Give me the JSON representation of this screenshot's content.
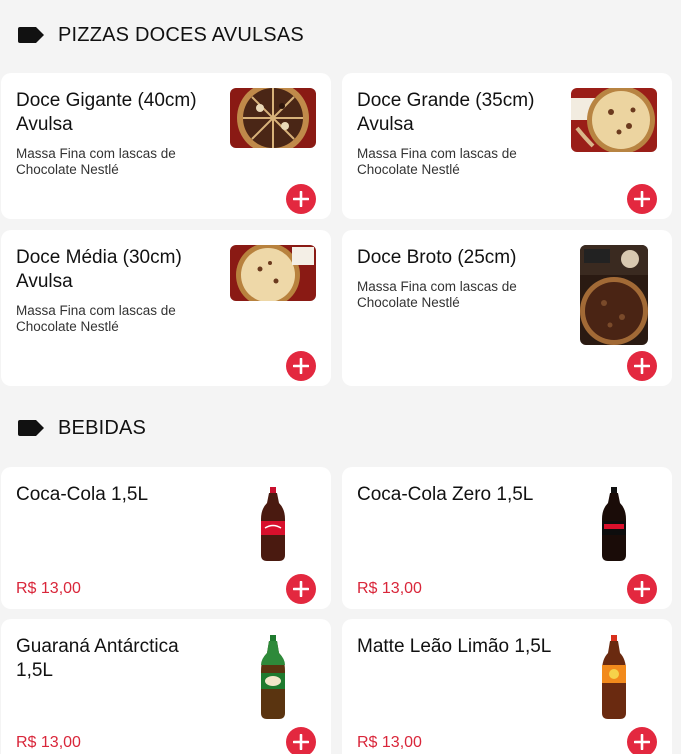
{
  "sections": [
    {
      "title": "PIZZAS DOCES AVULSAS",
      "icon": "tag-icon",
      "items": [
        {
          "title": "Doce Gigante (40cm) Avulsa",
          "description": "Massa Fina com lascas de Chocolate Nestlé"
        },
        {
          "title": "Doce Grande (35cm) Avulsa",
          "description": "Massa Fina com lascas de Chocolate Nestlé"
        },
        {
          "title": "Doce Média (30cm) Avulsa",
          "description": "Massa Fina com lascas de Chocolate Nestlé"
        },
        {
          "title": "Doce Broto (25cm)",
          "description": "Massa Fina com lascas de Chocolate Nestlé"
        }
      ]
    },
    {
      "title": "BEBIDAS",
      "icon": "tag-icon",
      "items": [
        {
          "title": "Coca-Cola 1,5L",
          "price": "R$ 13,00"
        },
        {
          "title": "Coca-Cola Zero 1,5L",
          "price": "R$ 13,00"
        },
        {
          "title": "Guaraná Antárctica 1,5L",
          "price": "R$ 13,00"
        },
        {
          "title": "Matte Leão Limão 1,5L",
          "price": "R$ 13,00"
        }
      ]
    }
  ],
  "add_icon": "plus-icon",
  "colors": {
    "accent": "#e3283f",
    "price": "#d9263a",
    "background": "#f4f4f4",
    "card": "#ffffff"
  }
}
